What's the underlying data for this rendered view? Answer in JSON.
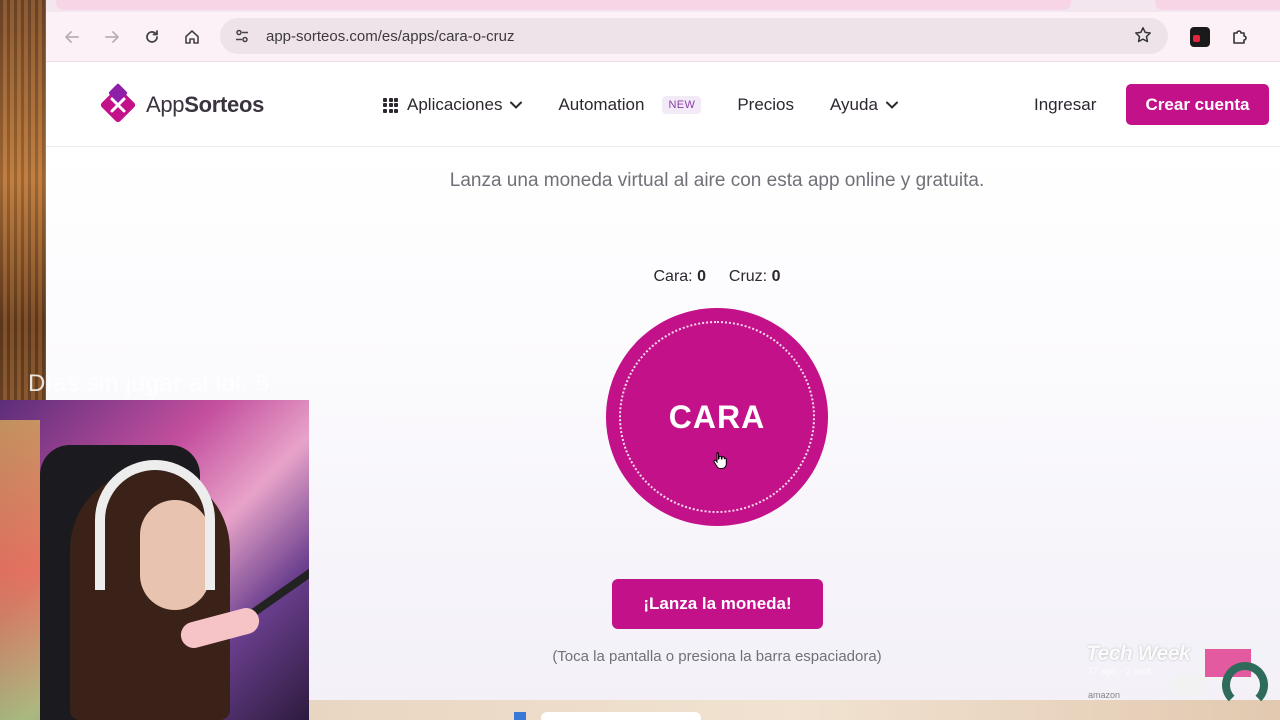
{
  "browser": {
    "url": "app-sorteos.com/es/apps/cara-o-cruz"
  },
  "site": {
    "brand_prefix": "App",
    "brand_suffix": "Sorteos",
    "nav": {
      "apps_label": "Aplicaciones",
      "automation_label": "Automation",
      "new_badge": "NEW",
      "pricing_label": "Precios",
      "help_label": "Ayuda"
    },
    "login_label": "Ingresar",
    "signup_label": "Crear cuenta",
    "accent_color": "#c3118a"
  },
  "coin_app": {
    "subtitle": "Lanza una moneda virtual al aire con esta app online y gratuita.",
    "heads_label": "Cara:",
    "heads_count": "0",
    "tails_label": "Cruz:",
    "tails_count": "0",
    "coin_face": "CARA",
    "toss_button": "¡Lanza la moneda!",
    "hint": "(Toca la pantalla o presiona la barra espaciadora)"
  },
  "overlay": {
    "stream_text": "Días sin jugar al lol: 5",
    "techweek_title": "Tech Week",
    "techweek_dates": "27 ago. - 2 sept.",
    "techweek_brand": "amazon"
  }
}
